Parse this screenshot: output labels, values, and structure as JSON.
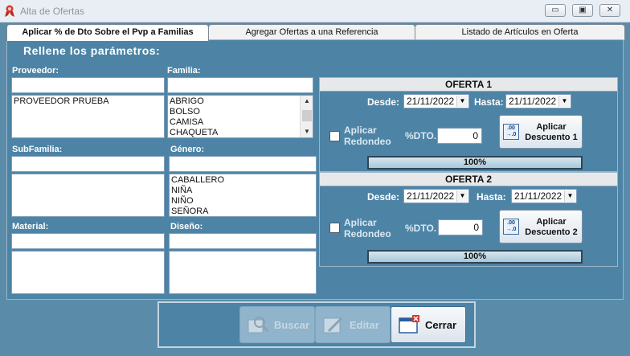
{
  "window": {
    "title": "Alta de Ofertas",
    "controls": {
      "minimize": "▭",
      "maximize": "▣",
      "close": "✕"
    }
  },
  "tabs": [
    {
      "label": "Aplicar % de Dto Sobre el Pvp a Familias",
      "active": true
    },
    {
      "label": "Agregar Ofertas a una Referencia",
      "active": false
    },
    {
      "label": "Listado de Artículos en Oferta",
      "active": false
    }
  ],
  "form": {
    "header": "Rellene los parámetros:",
    "proveedor": {
      "label": "Proveedor:",
      "value": "",
      "items": [
        "PROVEEDOR PRUEBA"
      ]
    },
    "familia": {
      "label": "Familia:",
      "value": "",
      "items": [
        "ABRIGO",
        "BOLSO",
        "CAMISA",
        "CHAQUETA"
      ]
    },
    "subfamilia": {
      "label": "SubFamilia:",
      "value": "",
      "items": []
    },
    "genero": {
      "label": "Género:",
      "value": "",
      "items": [
        "CABALLERO",
        "NIÑA",
        "NIÑO",
        "SEÑORA"
      ]
    },
    "material": {
      "label": "Material:",
      "value": "",
      "items": []
    },
    "diseno": {
      "label": "Diseño:",
      "value": "",
      "items": []
    }
  },
  "ofertas": [
    {
      "title": "OFERTA 1",
      "desde_label": "Desde:",
      "desde": "21/11/2022",
      "hasta_label": "Hasta:",
      "hasta": "21/11/2022",
      "redondeo_label_1": "Aplicar",
      "redondeo_label_2": "Redondeo",
      "dto_label": "%DTO.",
      "dto_value": "0",
      "button_line1": "Aplicar",
      "button_line2": "Descuento 1",
      "progress": 100,
      "progress_text": "100%"
    },
    {
      "title": "OFERTA 2",
      "desde_label": "Desde:",
      "desde": "21/11/2022",
      "hasta_label": "Hasta:",
      "hasta": "21/11/2022",
      "redondeo_label_1": "Aplicar",
      "redondeo_label_2": "Redondeo",
      "dto_label": "%DTO.",
      "dto_value": "0",
      "button_line1": "Aplicar",
      "button_line2": "Descuento 2",
      "progress": 100,
      "progress_text": "100%"
    }
  ],
  "buttons": {
    "buscar": "Buscar",
    "editar": "Editar",
    "cerrar": "Cerrar"
  },
  "icons": {
    "app": "ribbon-icon",
    "calc": "calculator-icon",
    "buscar": "magnifier-icon",
    "editar": "pencil-icon",
    "cerrar": "window-close-icon"
  }
}
